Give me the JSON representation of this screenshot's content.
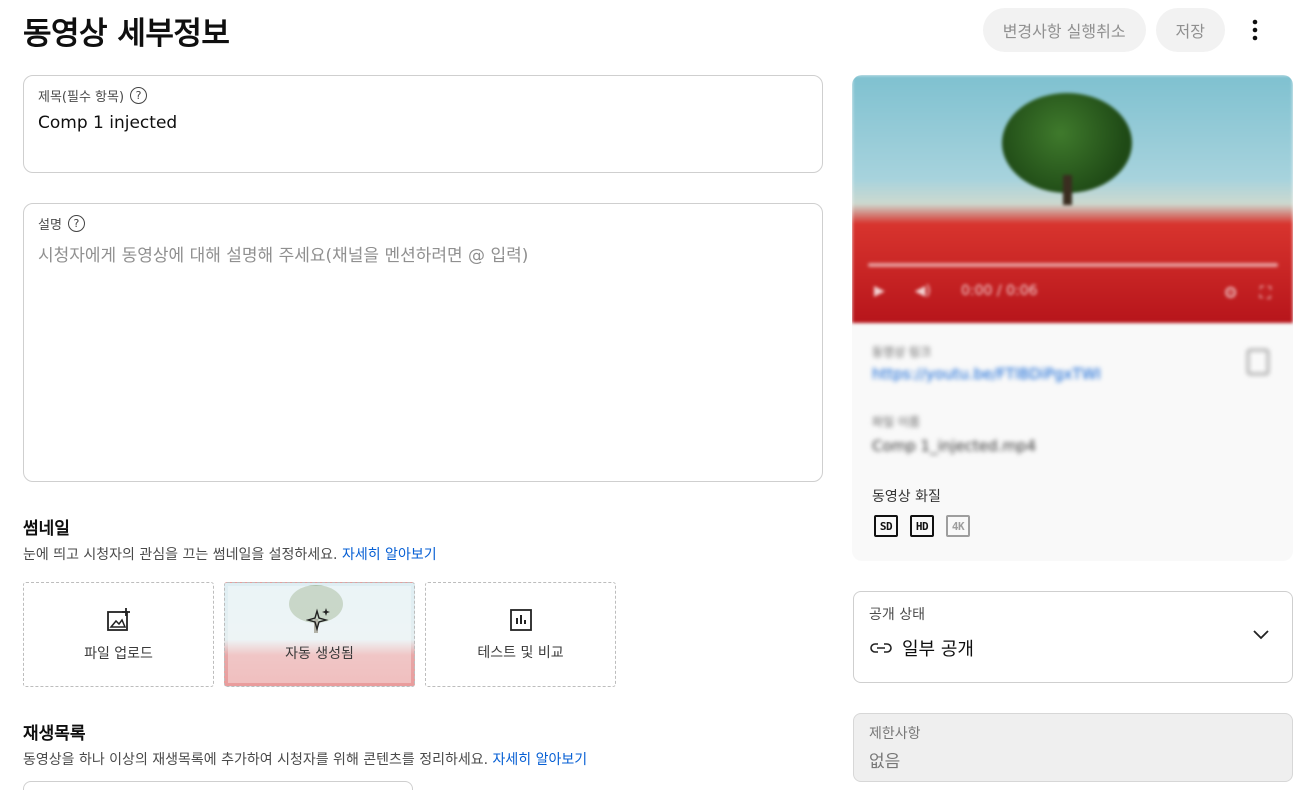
{
  "page": {
    "title": "동영상 세부정보"
  },
  "header": {
    "undo_label": "변경사항 실행취소",
    "save_label": "저장"
  },
  "title_field": {
    "label": "제목(필수 항목)",
    "help": "?",
    "value": "Comp 1 injected"
  },
  "description_field": {
    "label": "설명",
    "help": "?",
    "placeholder": "시청자에게 동영상에 대해 설명해 주세요(채널을 멘션하려면 @ 입력)"
  },
  "thumbnail": {
    "title": "썸네일",
    "desc": "눈에 띄고 시청자의 관심을 끄는 썸네일을 설정하세요. ",
    "link": "자세히 알아보기",
    "options": [
      {
        "label": "파일 업로드",
        "icon": "image-add-icon"
      },
      {
        "label": "자동 생성됨",
        "icon": "sparkle-icon"
      },
      {
        "label": "테스트 및 비교",
        "icon": "bar-chart-icon"
      }
    ]
  },
  "playlist": {
    "title": "재생목록",
    "desc": "동영상을 하나 이상의 재생목록에 추가하여 시청자를 위해 콘텐츠를 정리하세요. ",
    "link": "자세히 알아보기"
  },
  "video_panel": {
    "time": "0:00 / 0:06",
    "link_label": "동영상 링크",
    "link_value": "https://youtu.be/FTlBDiPgxTWI",
    "file_label": "파일 이름",
    "file_value": "Comp 1_injected.mp4",
    "quality_label": "동영상 화질",
    "quality_badges": [
      "SD",
      "HD",
      "4K"
    ]
  },
  "visibility": {
    "label": "공개 상태",
    "value": "일부 공개"
  },
  "restrictions": {
    "label": "제한사항",
    "value": "없음"
  },
  "colors": {
    "link": "#065fd4",
    "pill_bg": "#f2f2f2",
    "border": "#cfcfcf"
  }
}
